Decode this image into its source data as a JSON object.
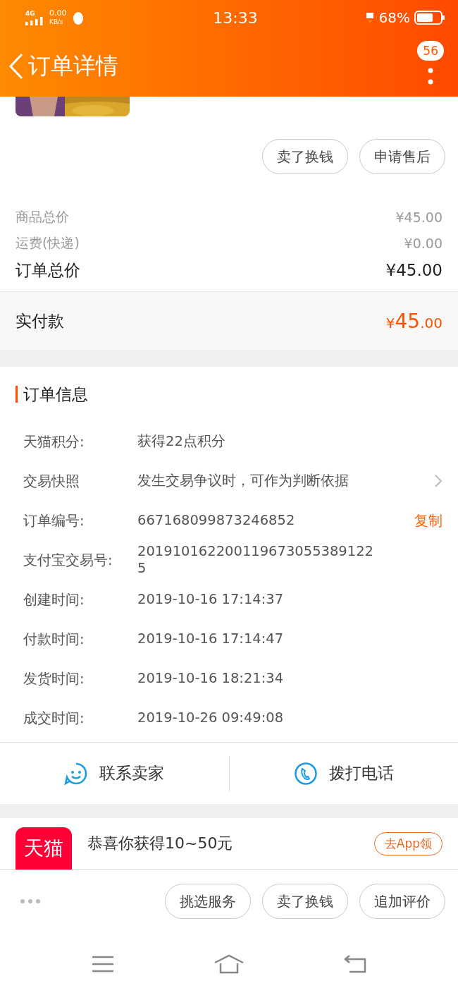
{
  "status_bar": {
    "network": "4G",
    "speed": "0.00",
    "speed_unit": "KB/s",
    "time": "13:33",
    "battery": "68%"
  },
  "header": {
    "title": "订单详情",
    "badge": "56"
  },
  "product": {
    "kind": "picture"
  },
  "product_actions": [
    "卖了换钱",
    "申请售后"
  ],
  "price_summary": [
    {
      "label": "商品总价",
      "value": "¥45.00",
      "kind": "minor"
    },
    {
      "label": "运费(快递)",
      "value": "¥0.00",
      "kind": "minor"
    },
    {
      "label": "订单总价",
      "value": "¥45.00",
      "kind": "total"
    }
  ],
  "payment": {
    "label": "实付款",
    "currency": "¥",
    "integer": "45",
    "decimal": ".00"
  },
  "order_info": {
    "title": "订单信息",
    "rows": [
      {
        "label": "天猫积分:",
        "value": "获得22点积分",
        "kind": "plain"
      },
      {
        "label": "交易快照",
        "value": "发生交易争议时，可作为判断依据",
        "kind": "link"
      },
      {
        "label": "订单编号:",
        "value": "667168099873246852",
        "kind": "copy",
        "action": "复制"
      },
      {
        "label": "支付宝交易号:",
        "value": "2019101622001196730553891225",
        "kind": "plain"
      },
      {
        "label": "创建时间:",
        "value": "2019-10-16 17:14:37",
        "kind": "plain"
      },
      {
        "label": "付款时间:",
        "value": "2019-10-16 17:14:47",
        "kind": "plain"
      },
      {
        "label": "发货时间:",
        "value": "2019-10-16 18:21:34",
        "kind": "plain"
      },
      {
        "label": "成交时间:",
        "value": "2019-10-26 09:49:08",
        "kind": "plain"
      }
    ]
  },
  "contact": [
    {
      "label": "联系卖家",
      "kind": "chat"
    },
    {
      "label": "拨打电话",
      "kind": "phone"
    }
  ],
  "promo": {
    "logo": "天猫",
    "text": "恭喜你获得10~50元",
    "button": "去App领"
  },
  "bottom_actions": [
    "挑选服务",
    "卖了换钱",
    "追加评价"
  ]
}
